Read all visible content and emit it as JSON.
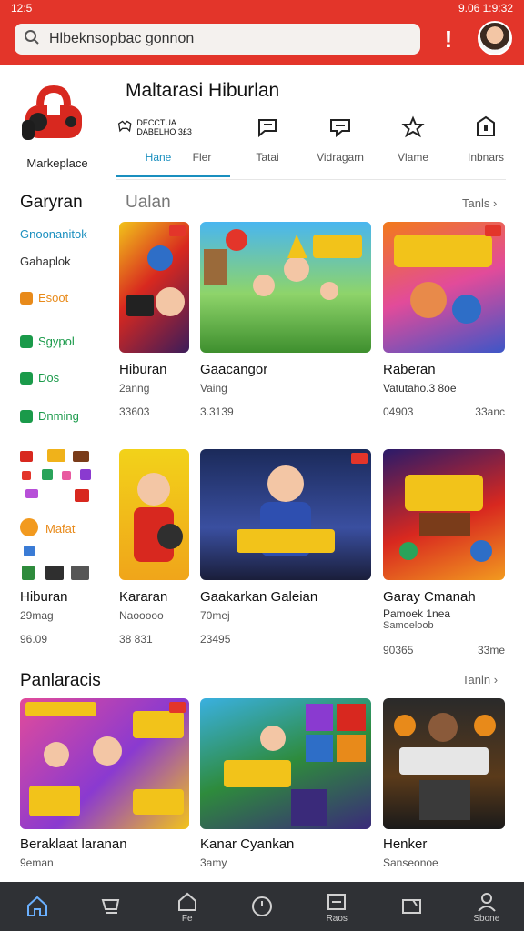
{
  "status_bar": {
    "time": "12:5",
    "right": "9.06  1:9:32"
  },
  "search": {
    "placeholder": "Hlbeknsopbac gonnon"
  },
  "alert_glyph": "!",
  "app": {
    "title": "Maltarasi Hiburlan",
    "logo_label": "Markeplace"
  },
  "tabs": [
    {
      "label": "Hane",
      "icon": "controller-icon",
      "sublabel": "DECCTUA DABELHO 3£3"
    },
    {
      "label": "Fler",
      "icon": "chat-bubble-icon"
    },
    {
      "label": "Tatai",
      "icon": "message-icon"
    },
    {
      "label": "Vidragarn",
      "icon": "star-badge-icon"
    },
    {
      "label": "Vlame",
      "icon": "shield-icon"
    },
    {
      "label": "Inbnars",
      "icon": "lock-icon"
    }
  ],
  "sidebar": {
    "title": "Garyran",
    "items": [
      {
        "label": "Gnoonanitok",
        "color": "blue"
      },
      {
        "label": "Gahaplok",
        "color": "plain"
      },
      {
        "label": "Esoot",
        "color": "orange"
      },
      {
        "label": "Sgypol",
        "color": "green"
      },
      {
        "label": "Dos",
        "color": "green"
      },
      {
        "label": "Dnming",
        "color": "green"
      }
    ],
    "promo_label": "Mafat"
  },
  "section1": {
    "label": "Ualan",
    "see_more": "Tanls"
  },
  "row1": [
    {
      "title": "Hiburan",
      "sub": "2anng",
      "meta": "33603",
      "right": ""
    },
    {
      "title": "Gaacangor",
      "sub": "Vaing",
      "meta": "3.3139",
      "right": ""
    },
    {
      "title": "Raberan",
      "sub": "Vatutaho.3 8oe",
      "meta": "04903",
      "right": "33anc"
    }
  ],
  "row2": [
    {
      "title": "Hiburan",
      "sub": "29mag",
      "meta": "96.09",
      "right": ""
    },
    {
      "title": "Kararan",
      "sub": "Naooooo",
      "meta": "38 831",
      "right": ""
    },
    {
      "title": "Gaakarkan Galeian",
      "sub": "70mej",
      "meta": "23495",
      "right": ""
    },
    {
      "title": "Garay Cmanah",
      "sub": "Pamoek 1nea",
      "sub2": "Samoeloob",
      "meta": "90365",
      "right": "33me"
    }
  ],
  "section2": {
    "label": "Panlaracis",
    "see_more": "Tanln"
  },
  "row3": [
    {
      "title": "Beraklaat laranan",
      "sub": "9eman"
    },
    {
      "title": "Kanar Cyankan",
      "sub": "3amy"
    },
    {
      "title": "Henker",
      "sub": "Sanseonoe"
    }
  ],
  "bottom_nav": [
    {
      "icon": "home-icon",
      "label": ""
    },
    {
      "icon": "cart-icon",
      "label": ""
    },
    {
      "icon": "house-outline-icon",
      "label": "Fe"
    },
    {
      "icon": "clock-icon",
      "label": ""
    },
    {
      "icon": "inbox-icon",
      "label": "Raos"
    },
    {
      "icon": "folder-icon",
      "label": ""
    },
    {
      "icon": "profile-icon",
      "label": "Sbone"
    }
  ]
}
